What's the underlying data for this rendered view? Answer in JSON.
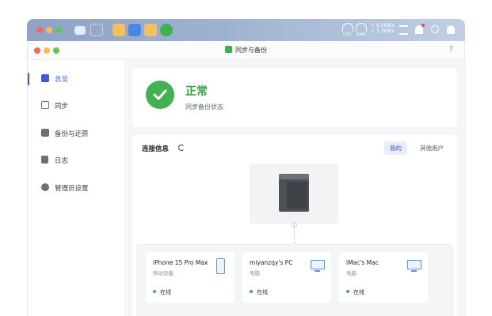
{
  "window": {
    "title": "同步与备份",
    "help": "?"
  },
  "tray": {
    "cpu_label": "CPU",
    "ram_label": "RAM",
    "upload_speed": "↑ 6.2KB/s",
    "download_speed": "↓ 3.2KB/s"
  },
  "sidebar": {
    "items": [
      {
        "label": "总览",
        "icon": "overview-icon"
      },
      {
        "label": "同步",
        "icon": "sync-icon"
      },
      {
        "label": "备份与还原",
        "icon": "backup-icon"
      },
      {
        "label": "日志",
        "icon": "log-icon"
      },
      {
        "label": "管理员设置",
        "icon": "gear-icon"
      }
    ]
  },
  "status": {
    "title": "正常",
    "subtitle": "同步备份状态"
  },
  "connections": {
    "title": "连接信息",
    "tabs": [
      "我的",
      "其他用户"
    ],
    "devices": [
      {
        "name": "iPhone 15 Pro Max",
        "type": "移动设备",
        "status": "在线"
      },
      {
        "name": "miyanzqy's PC",
        "type": "电脑",
        "status": "在线"
      },
      {
        "name": "iMac's Mac",
        "type": "电脑",
        "status": "在线"
      }
    ]
  },
  "colors": {
    "accent": "#3a5bd9",
    "success": "#43b14f",
    "dock_bar": "#9eb2d2"
  }
}
